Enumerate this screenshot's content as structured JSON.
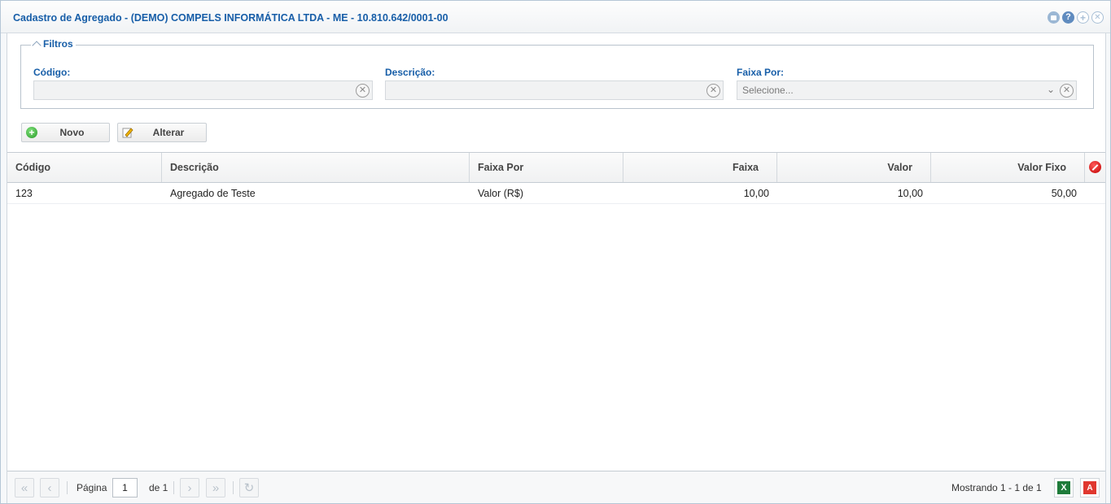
{
  "window": {
    "title": "Cadastro de Agregado - (DEMO) COMPELS INFORMÁTICA LTDA - ME - 10.810.642/0001-00"
  },
  "filters": {
    "legend": "Filtros",
    "codigo": {
      "label": "Código:",
      "value": ""
    },
    "descricao": {
      "label": "Descrição:",
      "value": ""
    },
    "faixa_por": {
      "label": "Faixa Por:",
      "placeholder": "Selecione..."
    }
  },
  "toolbar": {
    "novo_label": "Novo",
    "alterar_label": "Alterar"
  },
  "grid": {
    "columns": [
      "Código",
      "Descrição",
      "Faixa Por",
      "Faixa",
      "Valor",
      "Valor Fixo"
    ],
    "rows": [
      [
        "123",
        "Agregado de Teste",
        "Valor (R$)",
        "10,00",
        "10,00",
        "50,00"
      ]
    ]
  },
  "pager": {
    "page_label": "Página",
    "page_value": "1",
    "of_label": "de 1",
    "status": "Mostrando 1 - 1 de 1"
  },
  "icons": {
    "excel": "X",
    "pdf": "A"
  },
  "colors": {
    "title": "#175ea8",
    "label": "#175ea8",
    "excel": "#1e7b3a",
    "pdf": "#e0372f"
  }
}
